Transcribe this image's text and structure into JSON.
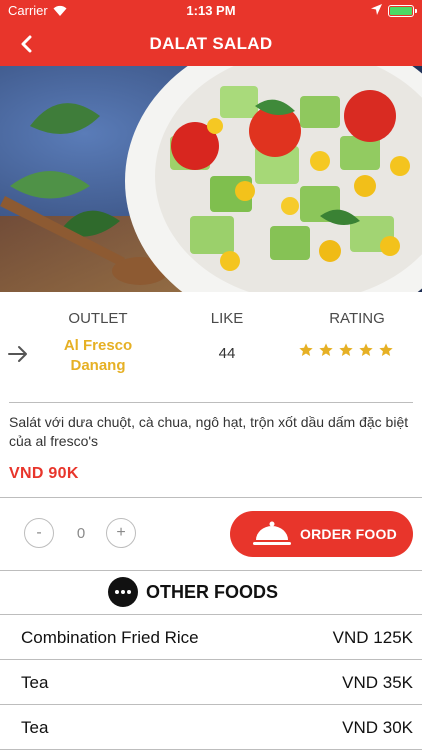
{
  "status_bar": {
    "carrier": "Carrier",
    "time": "1:13 PM",
    "battery_color": "#4cd964"
  },
  "nav": {
    "title": "DALAT SALAD",
    "back_icon": "chevron-left-icon",
    "bar_color": "#e8352b"
  },
  "info": {
    "outlet_header": "OUTLET",
    "like_header": "LIKE",
    "rating_header": "RATING",
    "outlet_name": "Al Fresco Danang",
    "like_count": "44",
    "rating": 5,
    "rating_max": 5,
    "star_color": "#e6b024"
  },
  "description": "Salát với dưa chuột, cà chua, ngô hạt, trộn xốt dầu dấm đặc biệt của al fresco's",
  "price": "VND  90K",
  "order": {
    "decrement_label": "-",
    "quantity": "0",
    "increment_label": "+",
    "button_label": "ORDER FOOD",
    "button_icon": "food-cloche-icon"
  },
  "other_foods": {
    "title": "OTHER FOODS",
    "icon": "more-icon",
    "items": [
      {
        "name": "Combination Fried Rice",
        "price": "VND  125K"
      },
      {
        "name": "Tea",
        "price": "VND  35K"
      },
      {
        "name": "Tea",
        "price": "VND  30K"
      }
    ]
  }
}
